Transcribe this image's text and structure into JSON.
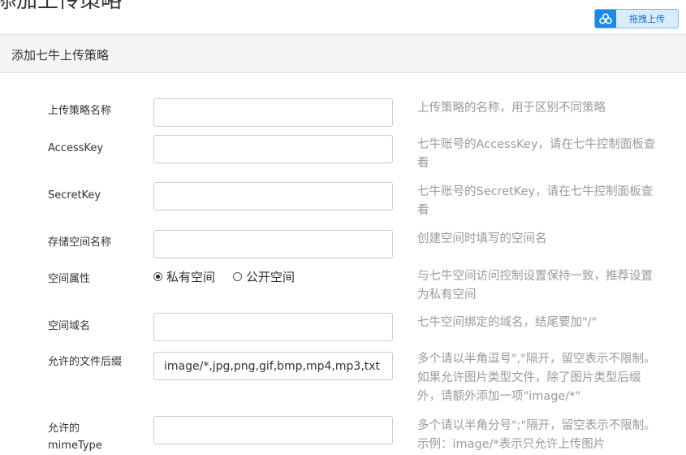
{
  "page": {
    "title": "添加上传策略"
  },
  "toolbar": {
    "drag_upload_label": "拖拽上传",
    "drag_upload_icon": "cloud-icon"
  },
  "panel": {
    "title": "添加七牛上传策略"
  },
  "form": {
    "policy_name": {
      "label": "上传策略名称",
      "value": "",
      "help": "上传策略的名称，用于区别不同策略"
    },
    "access_key": {
      "label": "AccessKey",
      "value": "",
      "help": "七牛账号的AccessKey，请在七牛控制面板查看"
    },
    "secret_key": {
      "label": "SecretKey",
      "value": "",
      "help": "七牛账号的SecretKey，请在七牛控制面板查看"
    },
    "bucket_name": {
      "label": "存储空间名称",
      "value": "",
      "help": "创建空间时填写的空间名"
    },
    "bucket_privacy": {
      "label": "空间属性",
      "options": [
        "私有空间",
        "公开空间"
      ],
      "selected": "私有空间",
      "help": "与七牛空间访问控制设置保持一致，推荐设置为私有空间"
    },
    "domain": {
      "label": "空间域名",
      "value": "",
      "help": "七牛空间绑定的域名，结尾要加\"/\""
    },
    "allowed_ext": {
      "label": "允许的文件后缀",
      "value": "image/*,jpg,png,gif,bmp,mp4,mp3,txt",
      "help": "多个请以半角逗号\",\"隔开，留空表示不限制。如果允许图片类型文件，除了图片类型后缀外，请额外添加一项\"image/*\""
    },
    "mime_type": {
      "label": "允许的mimeType",
      "value": "",
      "help": "多个请以半角分号\";\"隔开，留空表示不限制。示例：image/*表示只允许上传图片"
    }
  },
  "colors": {
    "accent": "#1a88e6",
    "help_text": "#9a9a9a",
    "panel_bg": "#f5f5f5"
  }
}
